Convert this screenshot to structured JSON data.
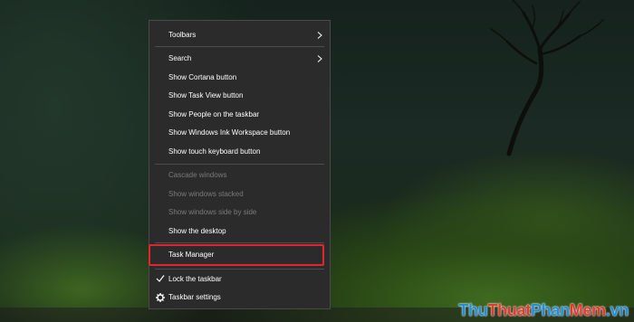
{
  "context_menu": {
    "items": [
      {
        "label": "Toolbars",
        "submenu": true,
        "enabled": true
      },
      {
        "label": "Search",
        "submenu": true,
        "enabled": true
      },
      {
        "label": "Show Cortana button",
        "enabled": true
      },
      {
        "label": "Show Task View button",
        "enabled": true
      },
      {
        "label": "Show People on the taskbar",
        "enabled": true
      },
      {
        "label": "Show Windows Ink Workspace button",
        "enabled": true
      },
      {
        "label": "Show touch keyboard button",
        "enabled": true
      },
      {
        "label": "Cascade windows",
        "enabled": false
      },
      {
        "label": "Show windows stacked",
        "enabled": false
      },
      {
        "label": "Show windows side by side",
        "enabled": false
      },
      {
        "label": "Show the desktop",
        "enabled": true
      },
      {
        "label": "Task Manager",
        "enabled": true,
        "highlighted": true
      },
      {
        "label": "Lock the taskbar",
        "enabled": true,
        "checked": true,
        "icon": "check-icon"
      },
      {
        "label": "Taskbar settings",
        "enabled": true,
        "icon": "gear-icon"
      }
    ]
  },
  "colors": {
    "menu_bg": "#2b2b2b",
    "text": "#ffffff",
    "disabled_text": "#7b7b7b",
    "highlight_border": "#e0262c"
  },
  "watermark": {
    "parts": [
      "Thu",
      "Thuat",
      "Phan",
      "Mem",
      ".vn"
    ]
  }
}
